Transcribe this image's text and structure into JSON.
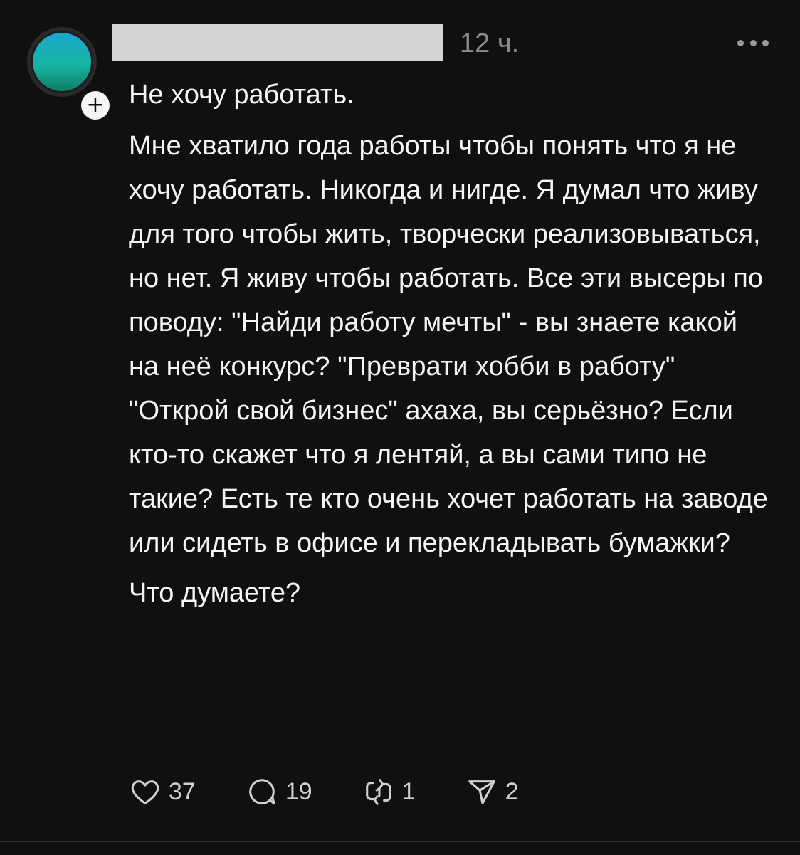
{
  "post": {
    "timestamp": "12 ч.",
    "title": "Не хочу работать.",
    "body": "Мне хватило года работы чтобы понять что я не хочу работать. Никогда и нигде. Я думал что живу для того чтобы жить, творчески реализовываться, но нет. Я живу чтобы работать. Все эти высеры по поводу: \"Найди работу мечты\" - вы знаете какой на неё конкурс? \"Преврати хобби в работу\" \"Открой свой бизнес\" ахаха, вы серьёзно? Если кто-то скажет что я лентяй, а вы сами типо не такие? Есть те кто очень хочет работать на заводе или сидеть в офисе и перекладывать бумажки?",
    "closing": "Что думаете?"
  },
  "actions": {
    "likes": "37",
    "comments": "19",
    "reposts": "1",
    "shares": "2"
  },
  "icons": {
    "like": "heart-icon",
    "comment": "comment-bubble-icon",
    "repost": "repost-icon",
    "share": "send-icon",
    "more": "more-dots-icon",
    "follow": "plus-icon"
  },
  "colors": {
    "background": "#101010",
    "text": "#f3f5f7",
    "muted": "#8a8a8a",
    "avatar_top": "#1aa6cf",
    "avatar_bottom": "#0e7d62",
    "redaction": "#d4d4d4"
  }
}
